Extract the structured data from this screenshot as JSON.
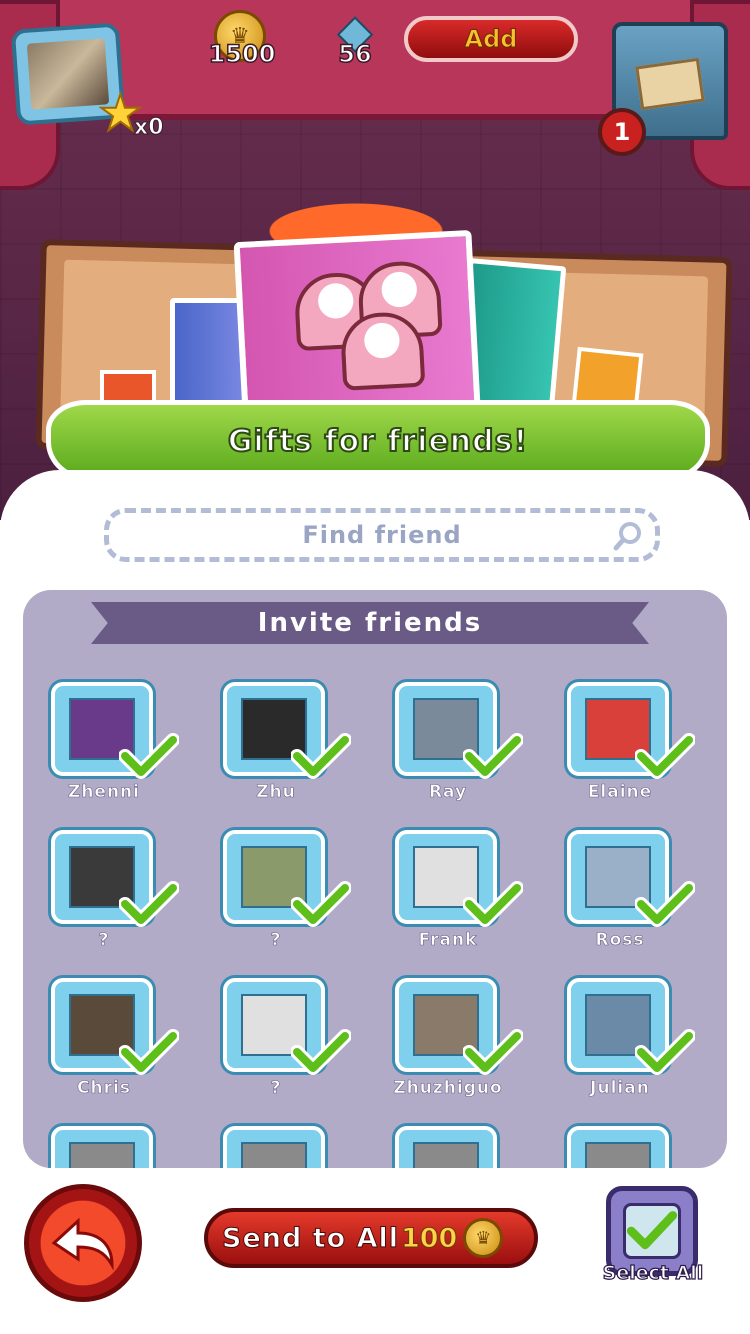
{
  "header": {
    "stars_count": "x0",
    "coins": "1500",
    "gems": "56",
    "add_label": "Add",
    "mail_badge": "1"
  },
  "banner": {
    "title": "Gifts for friends!"
  },
  "search": {
    "placeholder": "Find friend"
  },
  "invite": {
    "title": "Invite friends",
    "friends": [
      {
        "name": "Zhenni",
        "photo": "#6a3a8a"
      },
      {
        "name": "Zhu",
        "photo": "#2a2a2a"
      },
      {
        "name": "Ray",
        "photo": "#7a8a9a"
      },
      {
        "name": "Elaine",
        "photo": "#d9403a"
      },
      {
        "name": "?",
        "photo": "#3a3a3a"
      },
      {
        "name": "?",
        "photo": "#8a9a6a"
      },
      {
        "name": "Frank",
        "photo": "#e0e0e0"
      },
      {
        "name": "Ross",
        "photo": "#9ab0c8"
      },
      {
        "name": "Chris",
        "photo": "#5a4a3a"
      },
      {
        "name": "?",
        "photo": "#e0e0e0"
      },
      {
        "name": "Zhuzhiguo",
        "photo": "#8a7a6a"
      },
      {
        "name": "Julian",
        "photo": "#6a8aa8"
      }
    ]
  },
  "footer": {
    "send_label": "Send to All",
    "send_cost": "100",
    "select_all_label": "Select All"
  },
  "colors": {
    "curtain": "#b8365a",
    "ribbon": "#5aa91c",
    "panel": "#b2abc7",
    "header_band": "#695b86",
    "send_button": "#e43a2a"
  }
}
